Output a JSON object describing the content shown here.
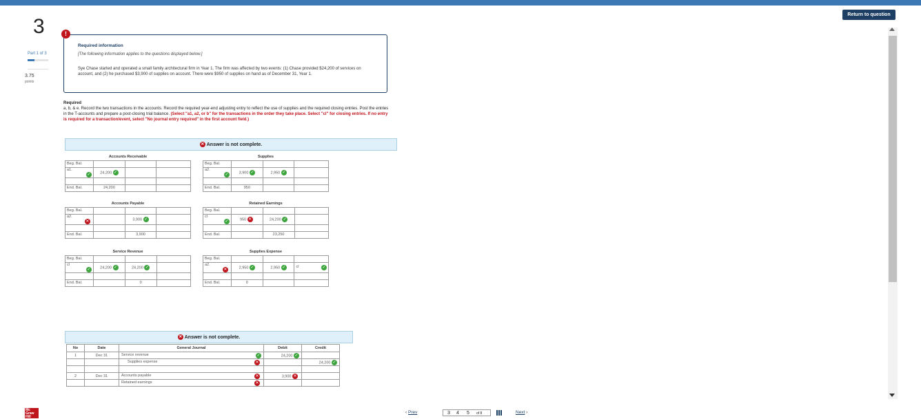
{
  "header": {
    "return_label": "Return to question"
  },
  "question": {
    "number": "3",
    "part": "Part 1 of 3",
    "points_value": "3.75",
    "points_label": "points"
  },
  "info": {
    "icon": "!",
    "title": "Required information",
    "intro": "[The following information applies to the questions displayed below.]",
    "paragraph": "Sye Chase started and operated a small family architectural firm in Year 1. The firm was affected by two events: (1) Chase provided $24,200 of services on account, and (2) he purchased $3,900 of supplies on account. There were $950 of supplies on hand as of December 31, Year 1."
  },
  "required": {
    "heading": "Required",
    "text": "a, b, & e. Record the two transactions in the accounts. Record the required year-end adjusting entry to reflect the use of supplies and the required closing entries. Post the entries in the T-accounts and prepare a post-closing trial balance.",
    "red_text": "(Select \"a1, a2, or b\" for the transactions in the order they take place. Select \"cl\" for closing entries. If no entry is required for a transaction/event, select \"No journal entry required\" in the first account field.)"
  },
  "banner1": {
    "text": "Answer is not complete."
  },
  "taccounts": [
    {
      "title": "Accounts Receivable",
      "rows": [
        [
          "Beg. Bal.",
          "",
          "",
          ""
        ],
        [
          "a1.",
          "24,200",
          "",
          ""
        ],
        [
          "",
          "",
          "",
          ""
        ],
        [
          "End. Bal.",
          "24,200",
          "",
          ""
        ]
      ]
    },
    {
      "title": "Supplies",
      "rows": [
        [
          "Beg. Bal.",
          "",
          "",
          ""
        ],
        [
          "a2.",
          "3,900",
          "2,950",
          ""
        ],
        [
          "",
          "",
          "",
          ""
        ],
        [
          "End. Bal.",
          "950",
          "",
          ""
        ]
      ]
    },
    {
      "title": "Accounts Payable",
      "rows": [
        [
          "Beg. Bal.",
          "",
          "",
          ""
        ],
        [
          "a2.",
          "",
          "3,900",
          ""
        ],
        [
          "",
          "",
          "",
          ""
        ],
        [
          "End. Bal.",
          "",
          "3,900",
          ""
        ]
      ]
    },
    {
      "title": "Retained Earnings",
      "rows": [
        [
          "Beg. Bal.",
          "",
          "",
          ""
        ],
        [
          "cl",
          "950",
          "24,200",
          ""
        ],
        [
          "",
          "",
          "",
          ""
        ],
        [
          "End. Bal.",
          "",
          "23,250",
          ""
        ]
      ]
    },
    {
      "title": "Service Revenue",
      "rows": [
        [
          "Beg. Bal.",
          "",
          "",
          ""
        ],
        [
          "cl",
          "24,200",
          "24,200",
          ""
        ],
        [
          "",
          "",
          "",
          ""
        ],
        [
          "End. Bal.",
          "",
          "0",
          ""
        ]
      ]
    },
    {
      "title": "Supplies Expense",
      "rows": [
        [
          "Beg. Bal.",
          "",
          "",
          ""
        ],
        [
          "a2.",
          "2,950",
          "2,950",
          "cl"
        ],
        [
          "",
          "",
          "",
          ""
        ],
        [
          "End. Bal.",
          "0",
          "",
          ""
        ]
      ]
    }
  ],
  "banner2": {
    "text": "Answer is not complete."
  },
  "journal": {
    "headers": [
      "No",
      "Date",
      "General Journal",
      "Debit",
      "Credit"
    ],
    "rows": [
      {
        "no": "1",
        "date": "Dec 31",
        "account": "Service revenue",
        "debit": "24,200",
        "credit": ""
      },
      {
        "no": "",
        "date": "",
        "account": "Supplies expense",
        "debit": "",
        "credit": "24,200"
      },
      {
        "no": "",
        "date": "",
        "account": "",
        "debit": "",
        "credit": ""
      },
      {
        "no": "2",
        "date": "Dec 31",
        "account": "Accounts payable",
        "debit": "3,900",
        "credit": ""
      },
      {
        "no": "",
        "date": "",
        "account": "Retained earnings",
        "debit": "",
        "credit": ""
      }
    ]
  },
  "footer": {
    "prev": "Prev",
    "pages": [
      "3",
      "4",
      "5"
    ],
    "of": "of 8",
    "next": "Next",
    "logo": "Mc Graw Hill"
  },
  "colors": {
    "brand": "#3c78b4",
    "navy": "#1d3f63",
    "error": "#c0141c",
    "ok": "#3da53d"
  }
}
